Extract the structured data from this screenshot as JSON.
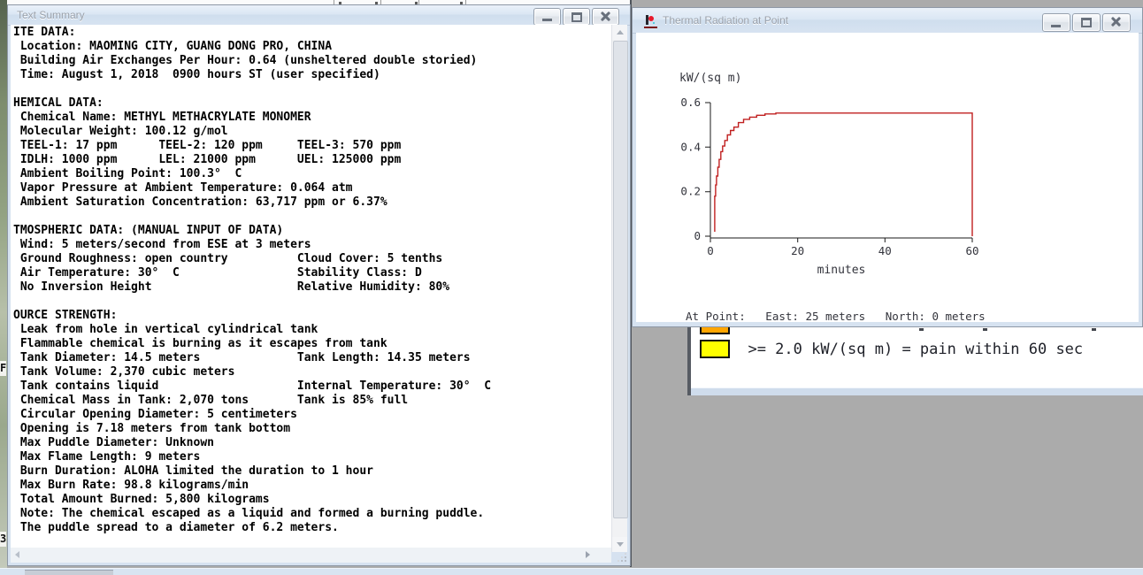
{
  "text_summary_window": {
    "title": "Text Summary",
    "lines": [
      "ITE DATA:",
      " Location: MAOMING CITY, GUANG DONG PRO, CHINA",
      " Building Air Exchanges Per Hour: 0.64 (unsheltered double storied)",
      " Time: August 1, 2018  0900 hours ST (user specified)",
      "",
      "HEMICAL DATA:",
      " Chemical Name: METHYL METHACRYLATE MONOMER",
      " Molecular Weight: 100.12 g/mol",
      " TEEL-1: 17 ppm      TEEL-2: 120 ppm     TEEL-3: 570 ppm",
      " IDLH: 1000 ppm      LEL: 21000 ppm      UEL: 125000 ppm",
      " Ambient Boiling Point: 100.3°  C",
      " Vapor Pressure at Ambient Temperature: 0.064 atm",
      " Ambient Saturation Concentration: 63,717 ppm or 6.37%",
      "",
      "TMOSPHERIC DATA: (MANUAL INPUT OF DATA)",
      " Wind: 5 meters/second from ESE at 3 meters",
      " Ground Roughness: open country          Cloud Cover: 5 tenths",
      " Air Temperature: 30°  C                 Stability Class: D",
      " No Inversion Height                     Relative Humidity: 80%",
      "",
      "OURCE STRENGTH:",
      " Leak from hole in vertical cylindrical tank",
      " Flammable chemical is burning as it escapes from tank",
      " Tank Diameter: 14.5 meters              Tank Length: 14.35 meters",
      " Tank Volume: 2,370 cubic meters",
      " Tank contains liquid                    Internal Temperature: 30°  C",
      " Chemical Mass in Tank: 2,070 tons       Tank is 85% full",
      " Circular Opening Diameter: 5 centimeters",
      " Opening is 7.18 meters from tank bottom",
      " Max Puddle Diameter: Unknown",
      " Max Flame Length: 9 meters",
      " Burn Duration: ALOHA limited the duration to 1 hour",
      " Max Burn Rate: 98.8 kilograms/min",
      " Total Amount Burned: 5,800 kilograms",
      " Note: The chemical escaped as a liquid and formed a burning puddle.",
      " The puddle spread to a diameter of 6.2 meters."
    ]
  },
  "thermal_window": {
    "title": "Thermal Radiation at Point",
    "at_point": "At Point:   East: 25 meters   North: 0 meters",
    "chart_data": {
      "type": "line",
      "title": "",
      "ylabel": "kW/(sq m)",
      "xlabel": "minutes",
      "xlim": [
        0,
        60
      ],
      "ylim": [
        0,
        0.6
      ],
      "xticks": [
        "0",
        "20",
        "40",
        "60"
      ],
      "yticks": [
        "0",
        "0.2",
        "0.4",
        "0.6"
      ],
      "grid": false,
      "legend_position": "none",
      "line_color": "#c02020",
      "series": [
        {
          "name": "thermal radiation at point (East 25 m, North 0 m)",
          "x": [
            1.0,
            1.0,
            1.2,
            1.4,
            1.7,
            2.0,
            2.4,
            2.8,
            3.3,
            3.9,
            4.6,
            5.4,
            6.4,
            7.6,
            9.0,
            10.6,
            12.5,
            15.0,
            60.0,
            60.0
          ],
          "y": [
            0.02,
            0.18,
            0.23,
            0.27,
            0.31,
            0.345,
            0.38,
            0.405,
            0.43,
            0.455,
            0.475,
            0.49,
            0.51,
            0.525,
            0.535,
            0.543,
            0.549,
            0.553,
            0.553,
            0.0
          ]
        }
      ]
    }
  },
  "legend_window": {
    "rows": [
      {
        "swatch_color": "#ffa500",
        "label": ""
      },
      {
        "swatch_color": "#ffff00",
        "label": ">= 2.0 kW/(sq m) = pain within 60 sec"
      }
    ]
  },
  "fragments": {
    "left_edge_top_char": "F",
    "left_edge_bottom_char": "3"
  },
  "colors": {
    "desktop": "#ababab",
    "curve_red": "#c02020",
    "swatch_yellow": "#ffff00",
    "swatch_orange": "#ffa500"
  }
}
